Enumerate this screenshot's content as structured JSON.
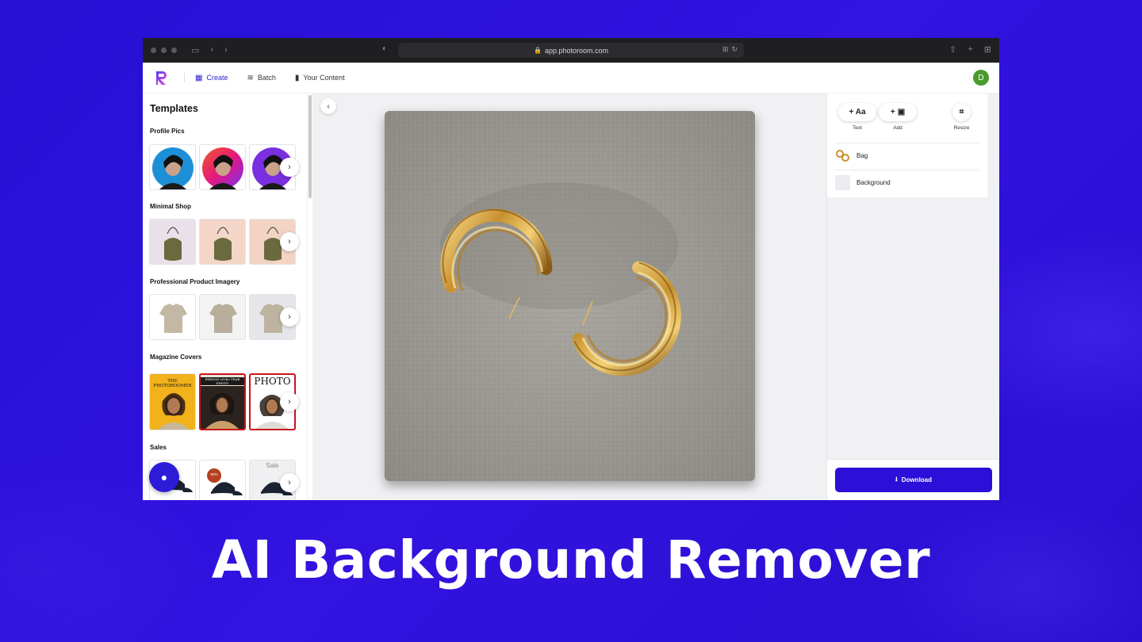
{
  "browser": {
    "url": "app.photoroom.com"
  },
  "header": {
    "nav": [
      {
        "label": "Create",
        "icon": "grid-icon"
      },
      {
        "label": "Batch",
        "icon": "layers-icon"
      },
      {
        "label": "Your Content",
        "icon": "folder-icon"
      }
    ],
    "avatar_initial": "D",
    "accent": "#2c1cd8"
  },
  "sidebar": {
    "title": "Templates",
    "sections": [
      {
        "title": "Profile Pics"
      },
      {
        "title": "Minimal Shop"
      },
      {
        "title": "Professional Product Imagery"
      },
      {
        "title": "Magazine Covers",
        "thumb_text": [
          "THE PHOTOROOMER",
          "PERSON of the YEAR PHOTO",
          "PHOTO"
        ]
      },
      {
        "title": "Sales",
        "thumb_text": [
          "",
          "50%",
          "Sale"
        ]
      }
    ]
  },
  "tools": {
    "text_label": "Text",
    "add_label": "Add",
    "resize_label": "Resize",
    "text_glyph": "+ Aa"
  },
  "layers": [
    {
      "name": "Bag"
    },
    {
      "name": "Background"
    }
  ],
  "download_label": "Download",
  "headline": "AI Background Remover"
}
